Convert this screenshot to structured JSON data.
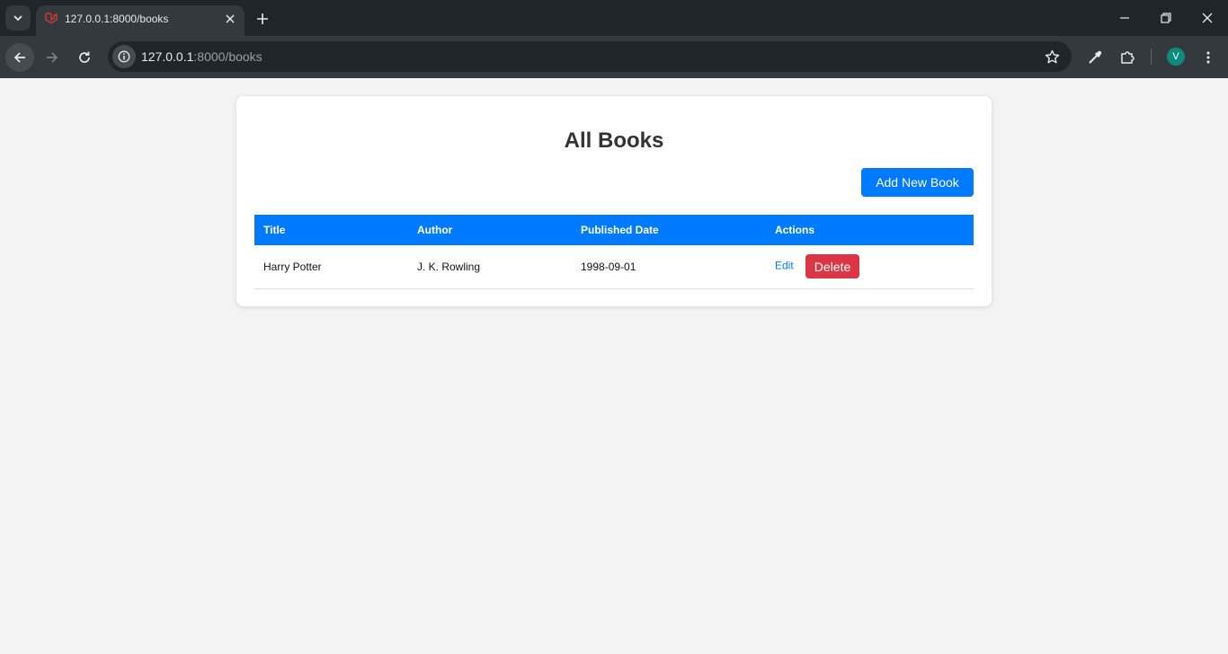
{
  "browser": {
    "tab_title": "127.0.0.1:8000/books",
    "url_host": "127.0.0.1",
    "url_path": ":8000/books",
    "profile_initial": "V",
    "accent_favicon": "#e53935",
    "avatar_color": "#0f8a7e"
  },
  "page": {
    "title": "All Books",
    "add_button_label": "Add New Book",
    "table": {
      "headers": [
        "Title",
        "Author",
        "Published Date",
        "Actions"
      ],
      "rows": [
        {
          "title": "Harry Potter",
          "author": "J. K. Rowling",
          "published_date": "1998-09-01",
          "edit_label": "Edit",
          "delete_label": "Delete"
        }
      ]
    },
    "colors": {
      "primary": "#007bff",
      "danger": "#dc3545",
      "background": "#f3f3f3"
    }
  }
}
